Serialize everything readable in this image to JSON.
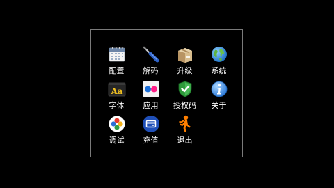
{
  "menu": {
    "items": [
      {
        "label": "配置",
        "icon": "calendar-icon"
      },
      {
        "label": "解码",
        "icon": "screwdriver-icon"
      },
      {
        "label": "升级",
        "icon": "package-box-icon"
      },
      {
        "label": "系统",
        "icon": "globe-icon"
      },
      {
        "label": "字体",
        "icon": "font-icon"
      },
      {
        "label": "应用",
        "icon": "flickr-dots-icon"
      },
      {
        "label": "授权码",
        "icon": "shield-check-icon"
      },
      {
        "label": "关于",
        "icon": "info-icon"
      },
      {
        "label": "调试",
        "icon": "colorful-circle-icon"
      },
      {
        "label": "充值",
        "icon": "credit-card-icon"
      },
      {
        "label": "退出",
        "icon": "running-man-icon"
      }
    ]
  },
  "colors": {
    "background": "#000000",
    "panel_border": "#7a7a7a",
    "label_text": "#ffffff"
  }
}
